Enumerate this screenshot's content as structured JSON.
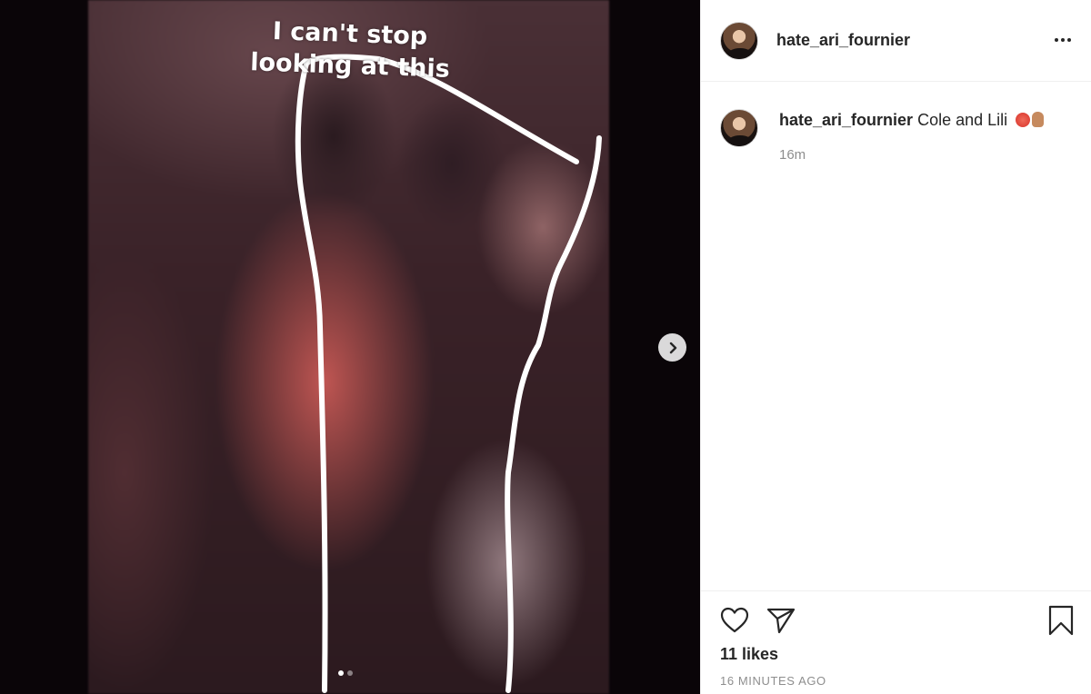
{
  "post": {
    "username": "hate_ari_fournier",
    "caption_text": "Cole and Lili",
    "caption_emoji": [
      "angry-face-emoji",
      "raised-hand-emoji"
    ],
    "relative_time": "16m",
    "likes": "11 likes",
    "timestamp": "16 MINUTES AGO"
  },
  "media": {
    "story_caption_line1": "I can't stop",
    "story_caption_line2": "looking at this",
    "carousel": {
      "total": 2,
      "current": 1
    }
  },
  "icons": {
    "next": "chevron-right-icon",
    "more": "more-options-icon",
    "like": "heart-icon",
    "share": "paper-plane-icon",
    "save": "bookmark-icon"
  },
  "colors": {
    "text": "#262626",
    "secondary_text": "#8e8e8e",
    "divider": "#efefef"
  }
}
